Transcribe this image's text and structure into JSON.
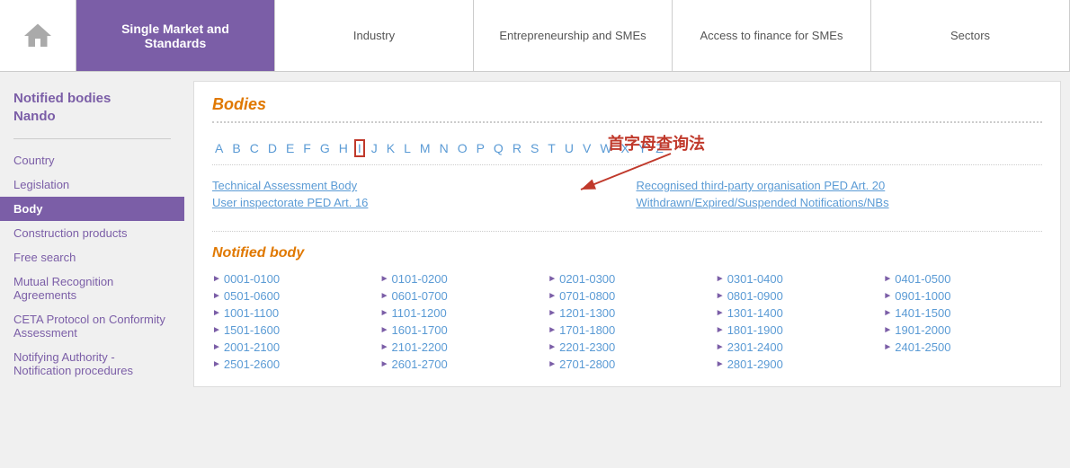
{
  "nav": {
    "home_icon": "home",
    "items": [
      {
        "id": "single-market",
        "label": "Single Market and Standards",
        "active": true
      },
      {
        "id": "industry",
        "label": "Industry",
        "active": false
      },
      {
        "id": "entrepreneurship",
        "label": "Entrepreneurship and SMEs",
        "active": false
      },
      {
        "id": "access-finance",
        "label": "Access to finance for SMEs",
        "active": false
      },
      {
        "id": "sectors",
        "label": "Sectors",
        "active": false
      }
    ]
  },
  "sidebar": {
    "title": "Notified bodies\nNando",
    "divider": true,
    "links": [
      {
        "id": "country",
        "label": "Country",
        "active": false
      },
      {
        "id": "legislation",
        "label": "Legislation",
        "active": false
      },
      {
        "id": "body",
        "label": "Body",
        "active": true
      },
      {
        "id": "construction",
        "label": "Construction products",
        "active": false
      },
      {
        "id": "free-search",
        "label": "Free search",
        "active": false
      },
      {
        "id": "mutual",
        "label": "Mutual Recognition Agreements",
        "active": false
      },
      {
        "id": "ceta",
        "label": "CETA Protocol on Conformity Assessment",
        "active": false
      },
      {
        "id": "notifying",
        "label": "Notifying Authority - Notification procedures",
        "active": false
      }
    ]
  },
  "content": {
    "bodies_title": "Bodies",
    "annotation_text": "首字母查询法",
    "alphabet": [
      "A",
      "B",
      "C",
      "D",
      "E",
      "F",
      "G",
      "H",
      "I",
      "J",
      "K",
      "L",
      "M",
      "N",
      "O",
      "P",
      "Q",
      "R",
      "S",
      "T",
      "U",
      "V",
      "W",
      "X",
      "Y",
      "Z"
    ],
    "selected_letter": "I",
    "top_links": [
      {
        "col1": [
          {
            "id": "tech-assessment",
            "label": "Technical Assessment Body"
          },
          {
            "id": "user-inspectorate",
            "label": "User inspectorate PED Art. 16"
          }
        ],
        "col2": [
          {
            "id": "recognised-third",
            "label": "Recognised third-party organisation PED Art. 20"
          },
          {
            "id": "withdrawn",
            "label": "Withdrawn/Expired/Suspended Notifications/NBs"
          }
        ]
      }
    ],
    "notified_body_title": "Notified body",
    "number_ranges": [
      "0001-0100",
      "0101-0200",
      "0201-0300",
      "0301-0400",
      "0401-0500",
      "0501-0600",
      "0601-0700",
      "0701-0800",
      "0801-0900",
      "0901-1000",
      "1101-1200",
      "1201-1300",
      "1301-1400",
      "1401-1500",
      "1501-1600",
      "1601-1700",
      "1701-1800",
      "1801-1900",
      "1901-2000",
      "2001-2100",
      "2101-2200",
      "2201-2300",
      "2301-2400",
      "2401-2500",
      "2501-2600",
      "2601-2700",
      "2701-2800",
      "2801-2900",
      "1001-1100"
    ],
    "number_ranges_ordered": [
      [
        "0001-0100",
        "0101-0200",
        "0201-0300",
        "0301-0400",
        "0401-0500"
      ],
      [
        "0501-0600",
        "0601-0700",
        "0701-0800",
        "0801-0900",
        "0901-1000"
      ],
      [
        "1001-1100",
        "1101-1200",
        "1201-1300",
        "1301-1400",
        "1401-1500"
      ],
      [
        "1501-1600",
        "1601-1700",
        "1701-1800",
        "1801-1900",
        "1901-2000"
      ],
      [
        "2001-2100",
        "2101-2200",
        "2201-2300",
        "2301-2400",
        "2401-2500"
      ],
      [
        "2501-2600",
        "2601-2700",
        "2701-2800",
        "2801-2900",
        ""
      ]
    ]
  }
}
